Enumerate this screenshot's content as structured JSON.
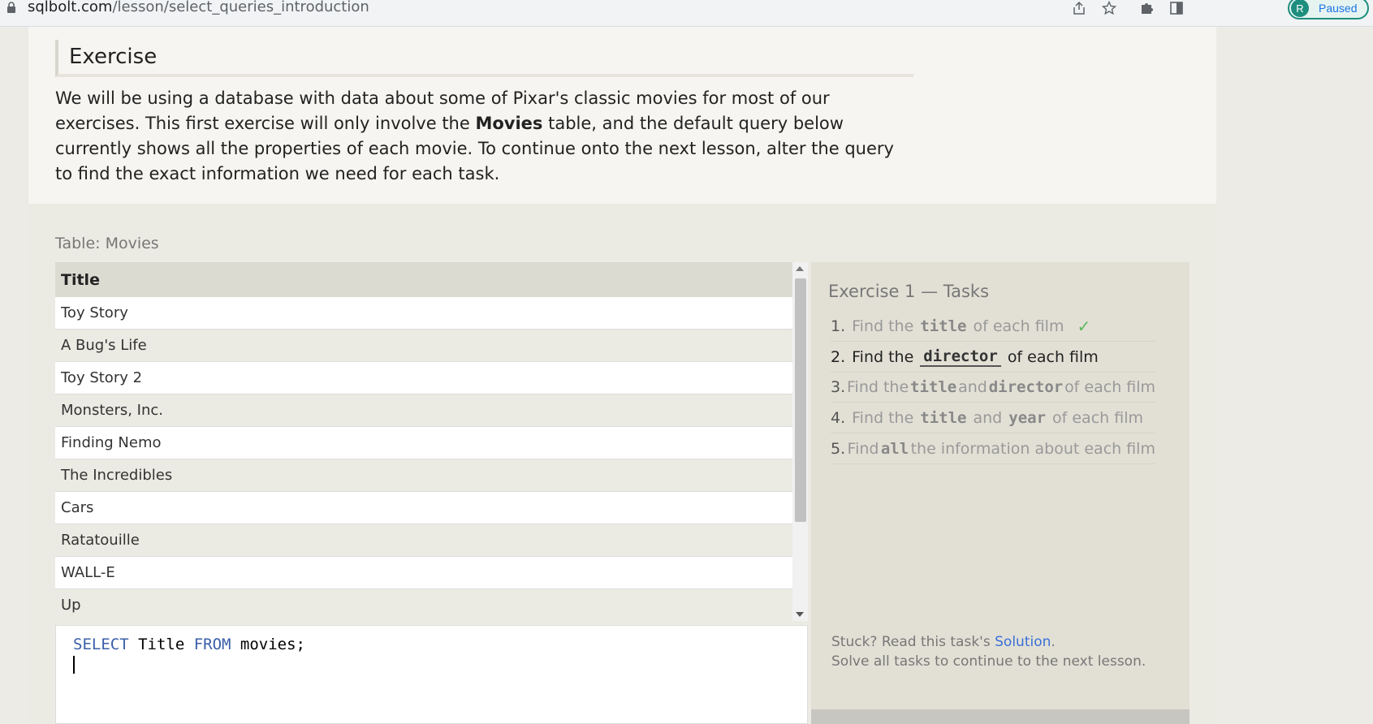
{
  "browser": {
    "url_host": "sqlbolt.com",
    "url_path": "/lesson/select_queries_introduction",
    "profile_initial": "R",
    "profile_status": "Paused"
  },
  "exercise": {
    "heading": "Exercise",
    "intro_part1": "We will be using a database with data about some of Pixar's classic movies for most of our exercises. This first exercise will only involve the ",
    "intro_bold": "Movies",
    "intro_part2": " table, and the default query below currently shows all the properties of each movie. To continue onto the next lesson, alter the query to find the exact information we need for each task."
  },
  "table": {
    "label": "Table: Movies",
    "header": "Title",
    "rows": [
      "Toy Story",
      "A Bug's Life",
      "Toy Story 2",
      "Monsters, Inc.",
      "Finding Nemo",
      "The Incredibles",
      "Cars",
      "Ratatouille",
      "WALL-E",
      "Up"
    ]
  },
  "editor": {
    "kw1": "SELECT",
    "t1": " Title ",
    "kw2": "FROM",
    "t2": " movies;"
  },
  "tasks": {
    "title": "Exercise 1 — Tasks",
    "items": [
      {
        "num": "1.",
        "pre": "Find the",
        "code1": "title",
        "mid": "",
        "code2": "",
        "post": "of each film",
        "check": "✓"
      },
      {
        "num": "2.",
        "pre": "Find the",
        "code1": "director",
        "post": "of each film"
      },
      {
        "num": "3.",
        "pre": "Find the",
        "code1": "title",
        "mid": "and",
        "code2": "director",
        "post": "of each film"
      },
      {
        "num": "4.",
        "pre": "Find the",
        "code1": "title",
        "mid": "and",
        "code2": "year",
        "post": "of each film"
      },
      {
        "num": "5.",
        "pre": "Find",
        "code1": "all",
        "post": "the information about each film"
      }
    ],
    "stuck_prefix": "Stuck? Read this task's ",
    "solution_link": "Solution",
    "stuck_suffix": ".",
    "continue_note": "Solve all tasks to continue to the next lesson."
  }
}
